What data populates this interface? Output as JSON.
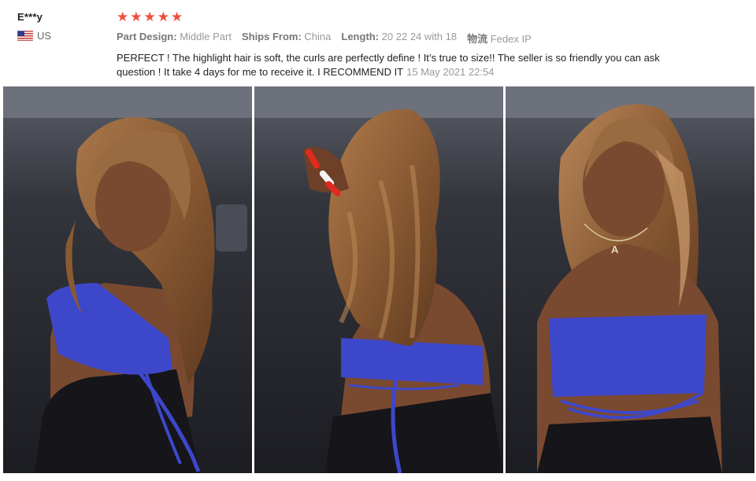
{
  "reviewer": {
    "name": "E***y",
    "country": "US",
    "flag_icon": "us-flag-icon"
  },
  "rating": {
    "stars": 5,
    "max": 5,
    "star_color": "#f04d3a"
  },
  "attributes": [
    {
      "label": "Part Design:",
      "value": "Middle Part"
    },
    {
      "label": "Ships From:",
      "value": "China"
    },
    {
      "label": "Length:",
      "value": "20 22 24 with 18"
    },
    {
      "label": "物流",
      "value": "Fedex IP"
    }
  ],
  "feedback": {
    "text": "PERFECT ! The highlight hair is soft, the curls are perfectly define ! It’s true to size!! The seller is so friendly you can ask question ! It take 4 days for me to receive it. I RECOMMEND IT",
    "date": "15 May 2021 22:54"
  },
  "photos": [
    {
      "name": "review-photo-1",
      "subject": "side-back pose, wavy highlight hair, blue halter top"
    },
    {
      "name": "review-photo-2",
      "subject": "back view, hand in hair, wavy highlight hair"
    },
    {
      "name": "review-photo-3",
      "subject": "front view, wavy highlight hair, letter A necklace"
    }
  ],
  "colors": {
    "hair": "#8a5a33",
    "top": "#3d47c9",
    "skin": "#7a4a30",
    "background": "#2a2b30"
  },
  "necklace_letter": "A"
}
